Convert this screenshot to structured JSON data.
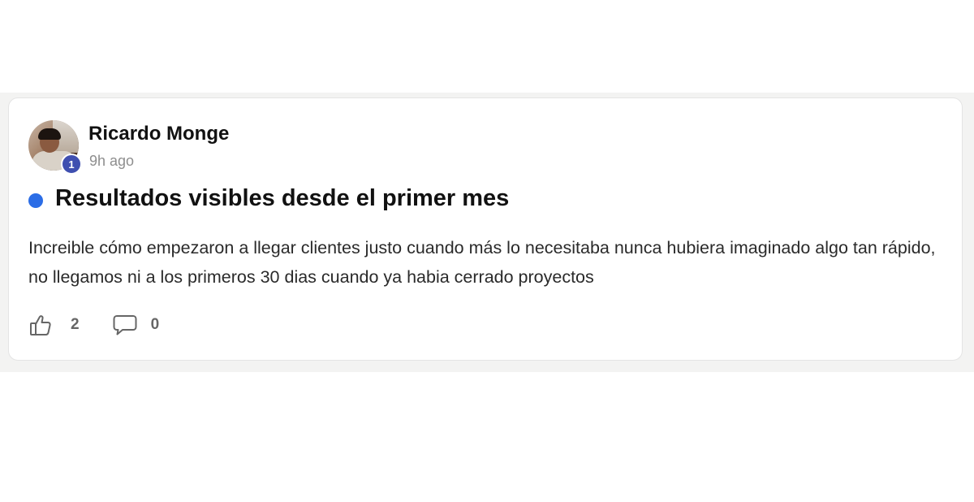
{
  "post": {
    "author": {
      "name": "Ricardo Monge",
      "level": "1",
      "timestamp": "9h ago"
    },
    "title": "Resultados visibles desde el primer mes",
    "body": "Increible cómo empezaron a llegar clientes justo cuando más lo necesitaba nunca hubiera imaginado algo tan rápido, no llegamos ni a los primeros 30 dias cuando ya habia cerrado proyectos",
    "likes": "2",
    "comments": "0",
    "unread_indicator_color": "#2b6de6",
    "level_badge_color": "#3f4fb0"
  },
  "icons": {
    "like": "thumbs-up-icon",
    "comment": "comment-bubble-icon"
  }
}
